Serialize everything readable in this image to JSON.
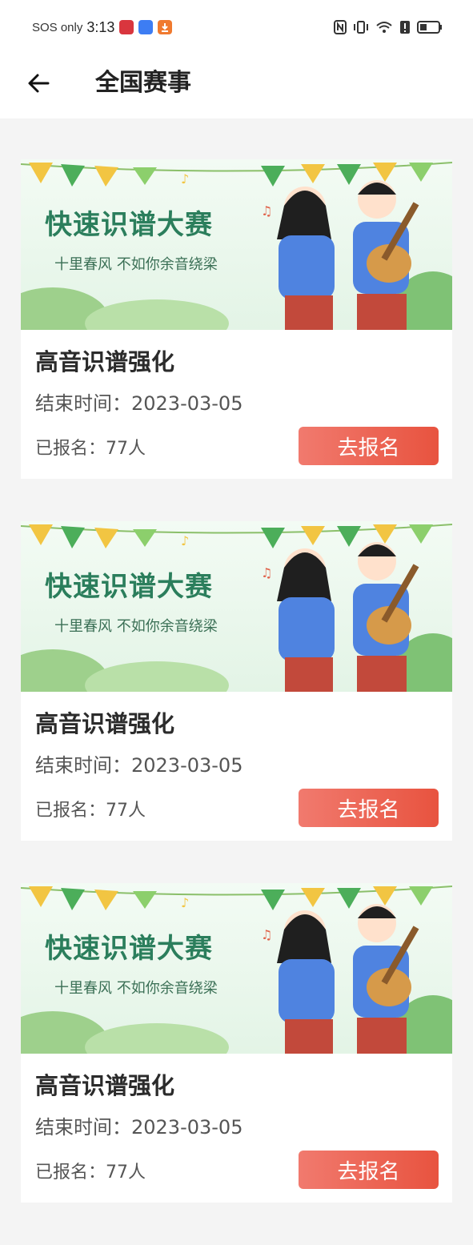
{
  "status_bar": {
    "carrier": "SOS only",
    "time": "3:13"
  },
  "header": {
    "title": "全国赛事"
  },
  "banner": {
    "title": "快速识谱大赛",
    "subtitle": "十里春风 不如你余音绕梁"
  },
  "events": [
    {
      "title": "高音识谱强化",
      "end_time": "结束时间：2023-03-05",
      "count": "已报名：77人",
      "button": "去报名"
    },
    {
      "title": "高音识谱强化",
      "end_time": "结束时间：2023-03-05",
      "count": "已报名：77人",
      "button": "去报名"
    },
    {
      "title": "高音识谱强化",
      "end_time": "结束时间：2023-03-05",
      "count": "已报名：77人",
      "button": "去报名"
    }
  ],
  "colors": {
    "accent": "#e8533f",
    "banner_green": "#2b7e5c",
    "background": "#f4f4f4"
  }
}
